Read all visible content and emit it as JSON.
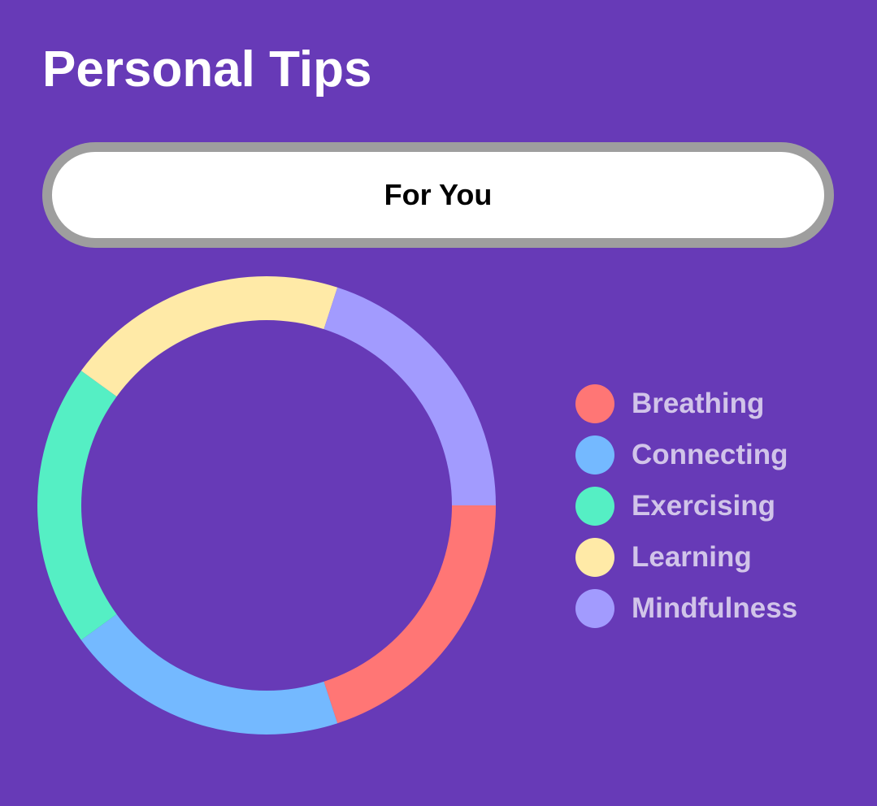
{
  "header": {
    "title": "Personal Tips"
  },
  "segment": {
    "selected_label": "For You"
  },
  "colors": {
    "background": "#673AB7",
    "pill_border": "#9E9E9E",
    "legend_text": "#D1C4E9"
  },
  "chart_data": {
    "type": "pie",
    "style": "donut",
    "legend_placement": "right",
    "series": [
      {
        "name": "Breathing",
        "value": 1,
        "color": "#FF7675"
      },
      {
        "name": "Connecting",
        "value": 1,
        "color": "#74B9FF"
      },
      {
        "name": "Exercising",
        "value": 1,
        "color": "#55EFC4"
      },
      {
        "name": "Learning",
        "value": 1,
        "color": "#FFEAA7"
      },
      {
        "name": "Mindfulness",
        "value": 1,
        "color": "#A29BFE"
      }
    ]
  }
}
